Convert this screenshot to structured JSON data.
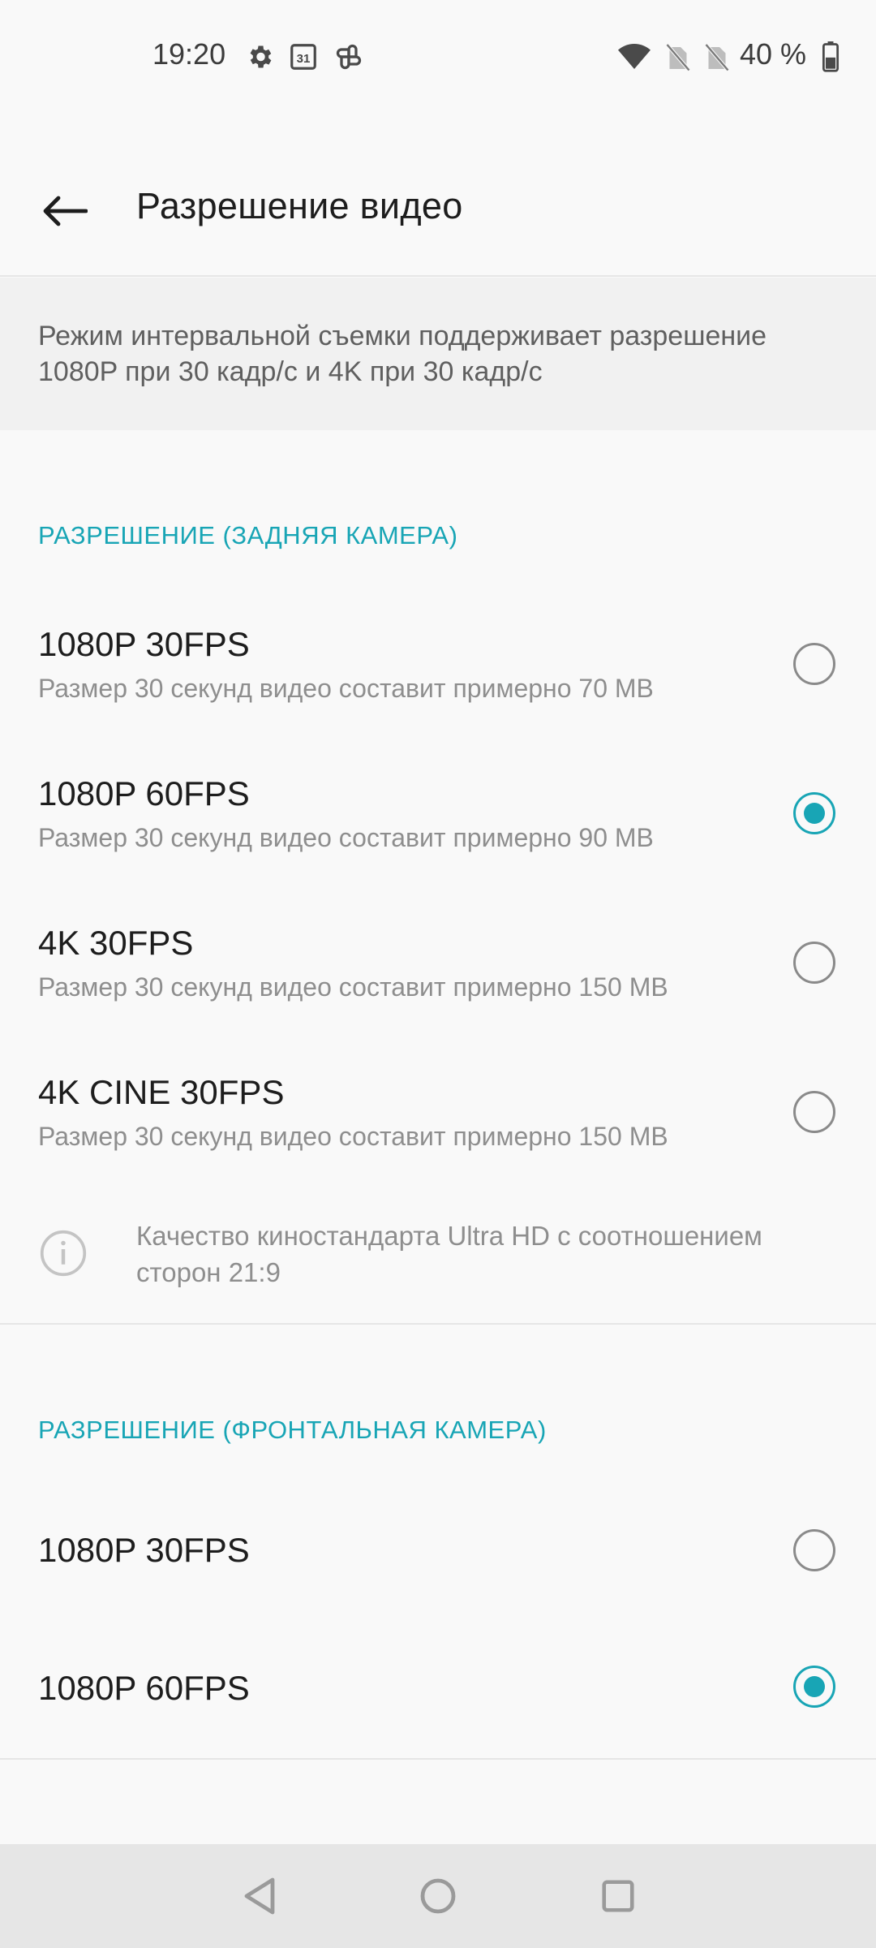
{
  "status_bar": {
    "time": "19:20",
    "calendar_day": "31",
    "battery_percent": "40 %",
    "icons": [
      "gear-icon",
      "calendar-icon",
      "pinwheel-icon",
      "wifi-icon",
      "no-sim-icon",
      "no-sim-icon",
      "battery-icon"
    ]
  },
  "toolbar": {
    "title": "Разрешение видео",
    "back_icon": "arrow-left-icon"
  },
  "info_banner": {
    "text": "Режим интервальной съемки поддерживает разрешение 1080P при 30 кадр/с и 4K при 30 кадр/с"
  },
  "rear_section": {
    "header": "РАЗРЕШЕНИЕ (ЗАДНЯЯ КАМЕРА)",
    "options": [
      {
        "title": "1080P 30FPS",
        "subtitle": "Размер 30 секунд видео составит примерно 70 MB",
        "selected": false
      },
      {
        "title": "1080P 60FPS",
        "subtitle": "Размер 30 секунд видео составит примерно 90 MB",
        "selected": true
      },
      {
        "title": "4K 30FPS",
        "subtitle": "Размер 30 секунд видео составит примерно 150 MB",
        "selected": false
      },
      {
        "title": "4K CINE 30FPS",
        "subtitle": "Размер 30 секунд видео составит примерно 150 MB",
        "selected": false
      }
    ],
    "note": "Качество киностандарта Ultra HD с соотношением сторон 21:9"
  },
  "front_section": {
    "header": "РАЗРЕШЕНИЕ (ФРОНТАЛЬНАЯ КАМЕРА)",
    "options": [
      {
        "title": "1080P 30FPS",
        "selected": false
      },
      {
        "title": "1080P 60FPS",
        "selected": true
      }
    ]
  },
  "nav_bar": {
    "buttons": [
      "back-triangle-icon",
      "home-circle-icon",
      "recents-square-icon"
    ]
  },
  "colors": {
    "accent": "#18a5b5",
    "background": "#f9f9f9",
    "banner": "#f1f1f1",
    "nav_bar": "#e6e6e6"
  }
}
